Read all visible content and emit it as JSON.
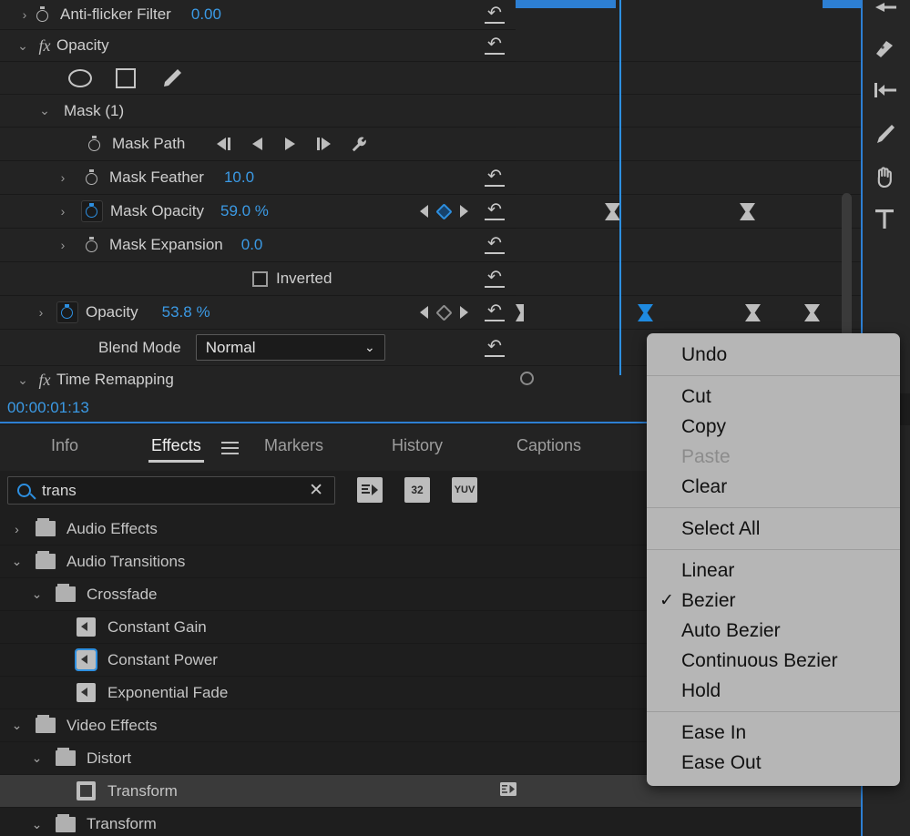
{
  "effect_controls": {
    "rows": [
      {
        "label": "Anti-flicker Filter",
        "value": "0.00"
      },
      {
        "label": "Opacity"
      },
      {
        "label": "Mask (1)"
      },
      {
        "label": "Mask Path"
      },
      {
        "label": "Mask Feather",
        "value": "10.0"
      },
      {
        "label": "Mask Opacity",
        "value": "59.0 %"
      },
      {
        "label": "Mask Expansion",
        "value": "0.0"
      },
      {
        "label": "Inverted"
      },
      {
        "label": "Opacity",
        "value": "53.8 %"
      },
      {
        "label": "Blend Mode",
        "value": "Normal"
      },
      {
        "label": "Time Remapping"
      }
    ],
    "timecode": "00:00:01:13"
  },
  "effects_panel": {
    "tabs": [
      {
        "label": "Info",
        "active": false
      },
      {
        "label": "Effects",
        "active": true
      },
      {
        "label": "Markers",
        "active": false
      },
      {
        "label": "History",
        "active": false
      },
      {
        "label": "Captions",
        "active": false
      }
    ],
    "search": {
      "value": "trans",
      "placeholder": ""
    },
    "badges": [
      "accelerated-effects",
      "32",
      "YUV"
    ],
    "tree": [
      {
        "label": "Audio Effects",
        "type": "folder",
        "depth": 0,
        "expanded": false
      },
      {
        "label": "Audio Transitions",
        "type": "folder",
        "depth": 0,
        "expanded": true
      },
      {
        "label": "Crossfade",
        "type": "folder",
        "depth": 1,
        "expanded": true
      },
      {
        "label": "Constant Gain",
        "type": "audio",
        "depth": 2
      },
      {
        "label": "Constant Power",
        "type": "audio",
        "depth": 2,
        "highlighted": true
      },
      {
        "label": "Exponential Fade",
        "type": "audio",
        "depth": 2
      },
      {
        "label": "Video Effects",
        "type": "folder",
        "depth": 0,
        "expanded": true
      },
      {
        "label": "Distort",
        "type": "folder",
        "depth": 1,
        "expanded": true
      },
      {
        "label": "Transform",
        "type": "video",
        "depth": 2,
        "selected": true
      },
      {
        "label": "Transform",
        "type": "folder",
        "depth": 0,
        "expanded": true
      }
    ]
  },
  "context_menu": {
    "groups": [
      [
        {
          "label": "Undo",
          "enabled": true,
          "checked": false
        }
      ],
      [
        {
          "label": "Cut",
          "enabled": true,
          "checked": false
        },
        {
          "label": "Copy",
          "enabled": true,
          "checked": false
        },
        {
          "label": "Paste",
          "enabled": false,
          "checked": false
        },
        {
          "label": "Clear",
          "enabled": true,
          "checked": false
        }
      ],
      [
        {
          "label": "Select All",
          "enabled": true,
          "checked": false
        }
      ],
      [
        {
          "label": "Linear",
          "enabled": true,
          "checked": false
        },
        {
          "label": "Bezier",
          "enabled": true,
          "checked": true
        },
        {
          "label": "Auto Bezier",
          "enabled": true,
          "checked": false
        },
        {
          "label": "Continuous Bezier",
          "enabled": true,
          "checked": false
        },
        {
          "label": "Hold",
          "enabled": true,
          "checked": false
        }
      ],
      [
        {
          "label": "Ease In",
          "enabled": true,
          "checked": false
        },
        {
          "label": "Ease Out",
          "enabled": true,
          "checked": false
        }
      ]
    ],
    "check_glyph": "✓"
  },
  "colors": {
    "accent_blue": "#2d8fe0",
    "value_blue": "#3b9ae5",
    "menu_bg": "#b6b6b6",
    "panel_bg": "#232323"
  }
}
